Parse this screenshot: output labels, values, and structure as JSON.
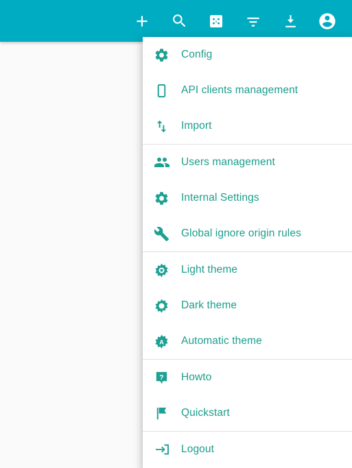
{
  "colors": {
    "appbar_bg": "#00acc1",
    "menu_text": "#1c9e8c",
    "menu_icon": "#1ea092",
    "page_bg": "#fafafa",
    "divider": "#e0e0e0"
  },
  "appbar": {
    "actions": [
      {
        "name": "add-button",
        "icon": "plus-icon",
        "label": "Add"
      },
      {
        "name": "search-button",
        "icon": "search-icon",
        "label": "Search"
      },
      {
        "name": "random-button",
        "icon": "dice-icon",
        "label": "Random"
      },
      {
        "name": "filter-button",
        "icon": "filter-icon",
        "label": "Filter"
      },
      {
        "name": "download-button",
        "icon": "download-icon",
        "label": "Download"
      },
      {
        "name": "account-button",
        "icon": "account-circle-icon",
        "label": "Account"
      }
    ]
  },
  "menu": {
    "groups": [
      {
        "items": [
          {
            "label": "Config",
            "icon": "gear-icon",
            "name": "menu-item-config"
          },
          {
            "label": "API clients management",
            "icon": "smartphone-icon",
            "name": "menu-item-api-clients-management"
          },
          {
            "label": "Import",
            "icon": "import-export-icon",
            "name": "menu-item-import"
          }
        ]
      },
      {
        "items": [
          {
            "label": "Users management",
            "icon": "people-icon",
            "name": "menu-item-users-management"
          },
          {
            "label": "Internal Settings",
            "icon": "gear-icon",
            "name": "menu-item-internal-settings"
          },
          {
            "label": "Global ignore origin rules",
            "icon": "wrench-icon",
            "name": "menu-item-global-ignore-origin-rules"
          }
        ]
      },
      {
        "items": [
          {
            "label": "Light theme",
            "icon": "sun-filled-icon",
            "name": "menu-item-light-theme"
          },
          {
            "label": "Dark theme",
            "icon": "sun-outline-icon",
            "name": "menu-item-dark-theme"
          },
          {
            "label": "Automatic theme",
            "icon": "sun-auto-icon",
            "name": "menu-item-automatic-theme"
          }
        ]
      },
      {
        "items": [
          {
            "label": "Howto",
            "icon": "help-icon",
            "name": "menu-item-howto"
          },
          {
            "label": "Quickstart",
            "icon": "flag-icon",
            "name": "menu-item-quickstart"
          }
        ]
      },
      {
        "items": [
          {
            "label": "Logout",
            "icon": "logout-icon",
            "name": "menu-item-logout"
          }
        ]
      }
    ]
  }
}
